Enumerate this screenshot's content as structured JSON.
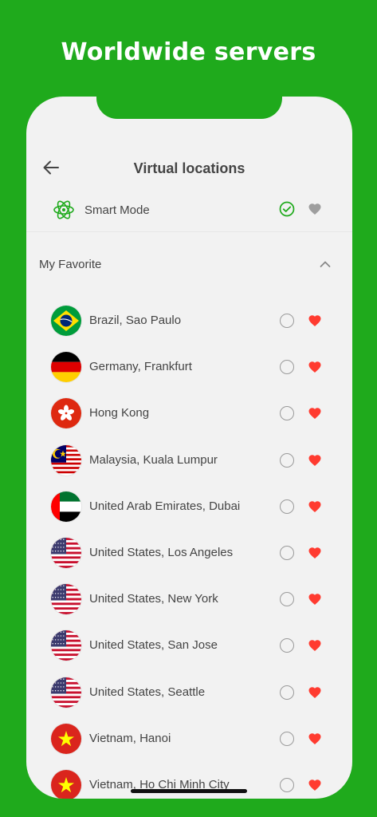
{
  "headline": "Worldwide servers",
  "nav": {
    "title": "Virtual locations",
    "back_icon": "arrow-left-icon"
  },
  "smart_mode": {
    "label": "Smart Mode",
    "icon": "atom-icon",
    "selected": true,
    "favorite": false
  },
  "favorites_section": {
    "label": "My Favorite",
    "expanded": true
  },
  "colors": {
    "brand_green": "#1faa1c",
    "heart_red": "#ff3b30",
    "heart_gray": "#9e9e9e",
    "check_green": "#1faa1c"
  },
  "locations": [
    {
      "name": "Brazil, Sao Paulo",
      "flag": "brazil",
      "selected": false,
      "favorite": true
    },
    {
      "name": "Germany, Frankfurt",
      "flag": "germany",
      "selected": false,
      "favorite": true
    },
    {
      "name": "Hong Kong",
      "flag": "hongkong",
      "selected": false,
      "favorite": true
    },
    {
      "name": "Malaysia, Kuala Lumpur",
      "flag": "malaysia",
      "selected": false,
      "favorite": true
    },
    {
      "name": "United Arab Emirates, Dubai",
      "flag": "uae",
      "selected": false,
      "favorite": true
    },
    {
      "name": "United States, Los Angeles",
      "flag": "usa",
      "selected": false,
      "favorite": true
    },
    {
      "name": "United States, New York",
      "flag": "usa",
      "selected": false,
      "favorite": true
    },
    {
      "name": "United States, San Jose",
      "flag": "usa",
      "selected": false,
      "favorite": true
    },
    {
      "name": "United States, Seattle",
      "flag": "usa",
      "selected": false,
      "favorite": true
    },
    {
      "name": "Vietnam, Hanoi",
      "flag": "vietnam",
      "selected": false,
      "favorite": true
    },
    {
      "name": "Vietnam, Ho Chi Minh City",
      "flag": "vietnam",
      "selected": false,
      "favorite": true
    }
  ]
}
